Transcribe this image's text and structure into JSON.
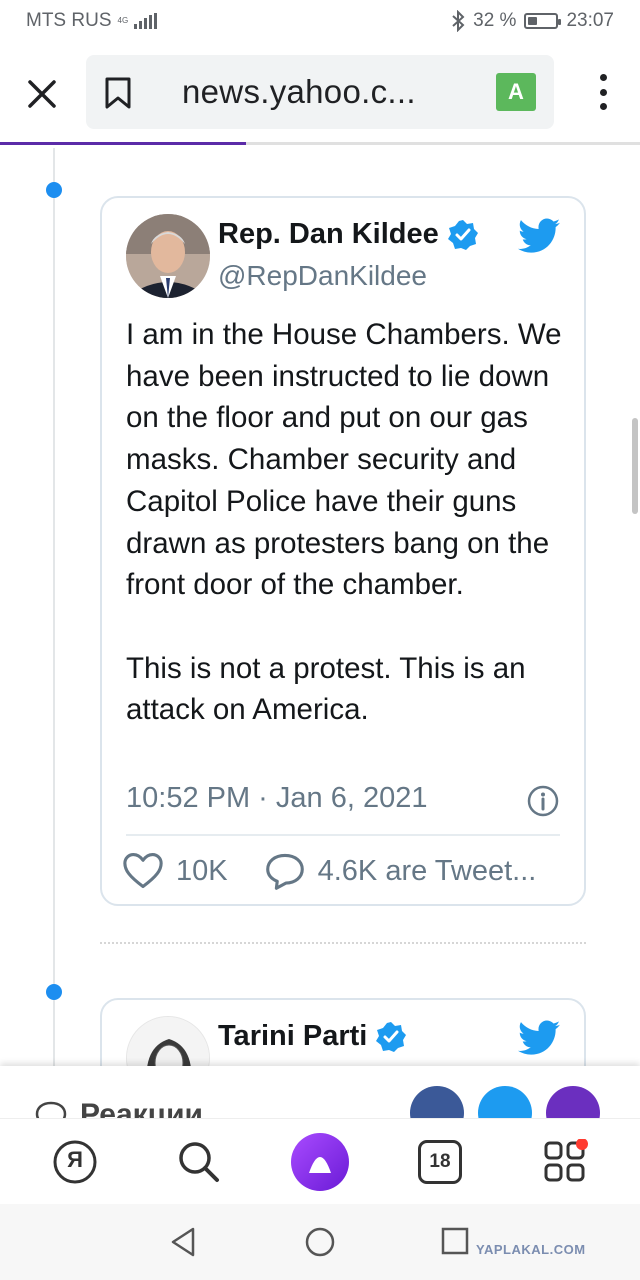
{
  "status_bar": {
    "carrier": "MTS RUS",
    "network_type_top": "4G",
    "network_type_bottom": "",
    "battery_percent": "32 %",
    "battery_level": 0.32,
    "time": "23:07"
  },
  "toolbar": {
    "url": "news.yahoo.c...",
    "translate_label": "A",
    "page_load_progress": 0.385
  },
  "tweets": [
    {
      "author": "Rep. Dan Kildee",
      "handle": "@RepDanKildee",
      "text": "I am in the House Chambers. We have been instructed to lie down on the floor and put on our gas masks. Chamber security and Capitol Police have their guns drawn as protesters bang on the front door of the chamber.\n\nThis is not a protest. This is an attack on America.",
      "timestamp": "10:52 PM · Jan 6, 2021",
      "likes": "10K",
      "replies": "4.6K are Tweet..."
    },
    {
      "author": "Tarini Parti"
    }
  ],
  "reactions": {
    "label": "Реакции"
  },
  "bottom_bar": {
    "yandex_label": "Я",
    "tabs_count": "18"
  },
  "watermark": "YAPLAKAL.COM",
  "colors": {
    "accent_blue": "#1d9bf0",
    "progress": "#5b2ba8",
    "alice": "#8a2be2"
  }
}
